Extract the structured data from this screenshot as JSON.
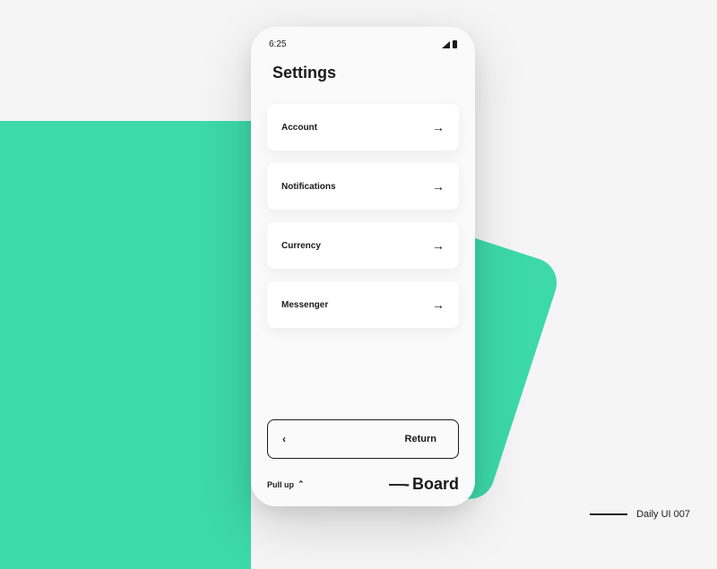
{
  "status": {
    "time": "6:25"
  },
  "page": {
    "title": "Settings"
  },
  "settings": {
    "items": [
      {
        "label": "Account"
      },
      {
        "label": "Notifications"
      },
      {
        "label": "Currency"
      },
      {
        "label": "Messenger"
      }
    ]
  },
  "return_button": {
    "label": "Return"
  },
  "pull_up": {
    "label": "Pull up"
  },
  "brand": {
    "prefix": "—-",
    "name": "Board"
  },
  "footer": {
    "label": "Daily UI 007"
  }
}
